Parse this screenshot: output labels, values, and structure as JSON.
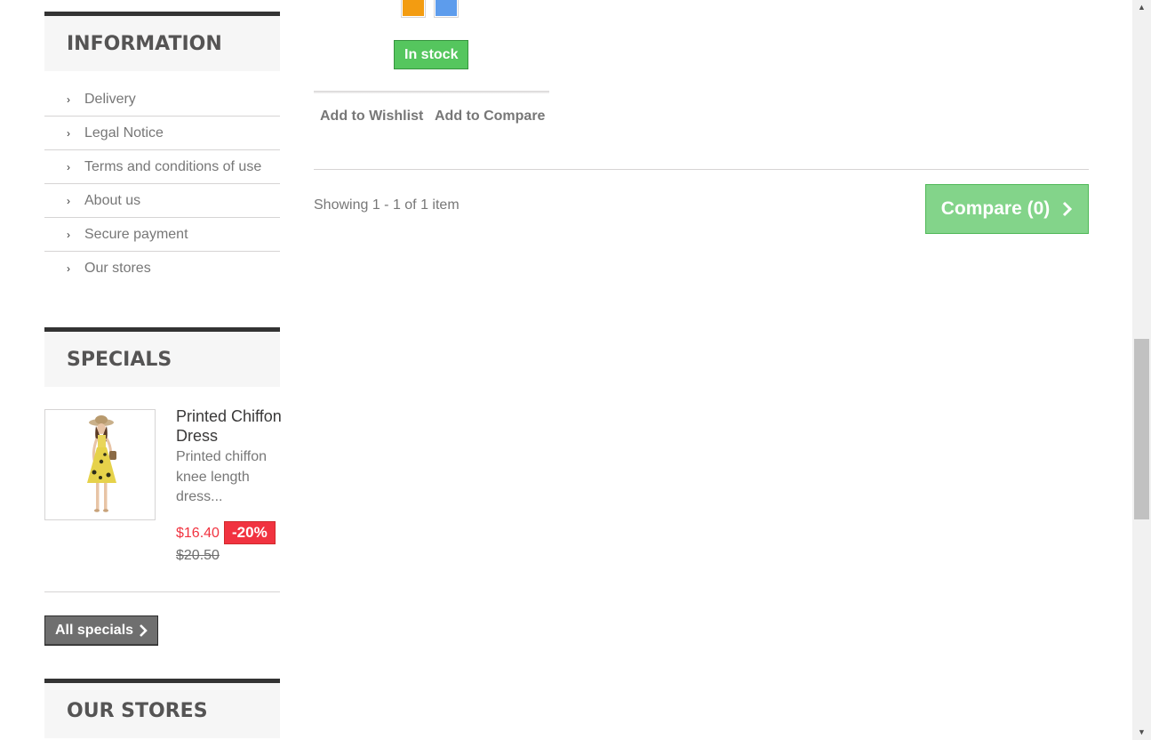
{
  "information": {
    "title": "INFORMATION",
    "items": [
      {
        "label": "Delivery"
      },
      {
        "label": "Legal Notice"
      },
      {
        "label": "Terms and conditions of use"
      },
      {
        "label": "About us"
      },
      {
        "label": "Secure payment"
      },
      {
        "label": "Our stores"
      }
    ]
  },
  "specials": {
    "title": "SPECIALS",
    "product": {
      "name": "Printed Chiffon Dress",
      "description": "Printed chiffon knee length dress...",
      "price": "$16.40",
      "discount": "-20%",
      "old_price": "$20.50"
    },
    "all_specials_label": "All specials"
  },
  "stores": {
    "title": "OUR STORES"
  },
  "product_card": {
    "swatch_colors": [
      "#f39c11",
      "#5d9cec"
    ],
    "availability": "In stock",
    "wishlist_label": "Add to Wishlist",
    "compare_label": "Add to Compare"
  },
  "listing": {
    "showing_text": "Showing 1 - 1 of 1 item",
    "compare_button_label": "Compare (0)"
  },
  "icons": {
    "list_chevron": "chevron-right-icon",
    "button_chevron": "chevron-right-icon",
    "scroll_up": "scroll-up-arrow",
    "scroll_down": "scroll-down-arrow"
  },
  "colors": {
    "in_stock": "#55c65e",
    "compare": "#83d48a",
    "sale": "#f13340",
    "block_border": "#333333"
  }
}
